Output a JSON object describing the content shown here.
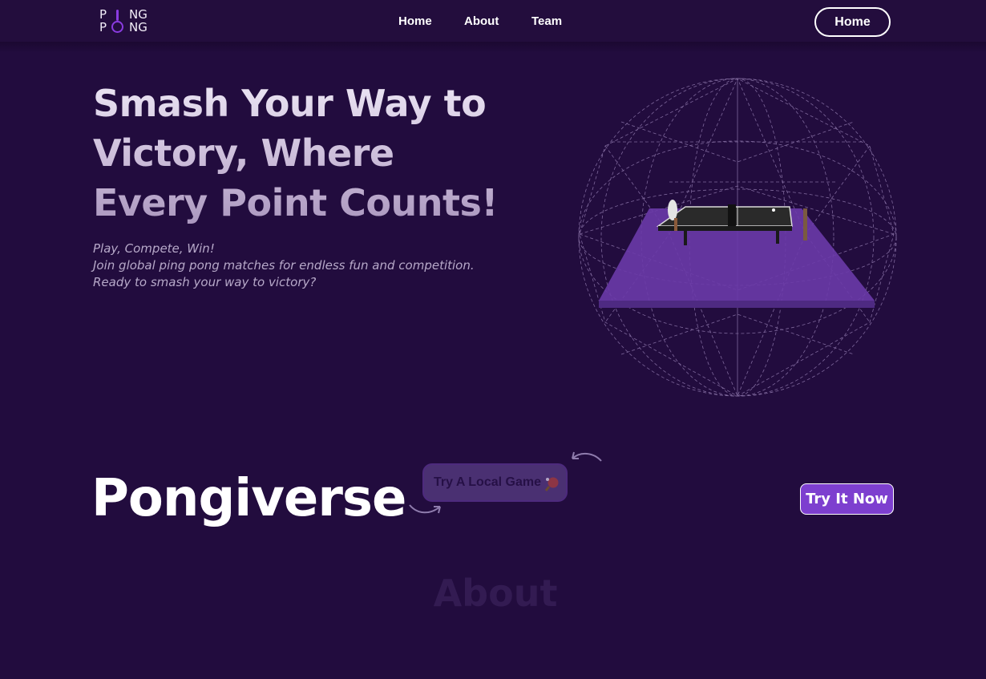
{
  "logo": {
    "top_row": [
      "P",
      "NG"
    ],
    "bottom_row": [
      "P",
      "NG"
    ]
  },
  "nav": {
    "links": [
      "Home",
      "About",
      "Team"
    ],
    "button_label": "Home"
  },
  "hero": {
    "title": "Smash Your Way to Victory, Where Every Point Counts!",
    "subtitle_lines": [
      "Play, Compete, Win!",
      "Join global ping pong matches for endless fun and competition.",
      "Ready to smash your way to victory?"
    ]
  },
  "scene": {
    "globe_color": "#9d86bb",
    "table_floor_color": "#6a3aa8",
    "table_top_color": "#2a2a2a"
  },
  "section": {
    "brand": "Pongiverse",
    "local_game_label": "Try A Local Game",
    "cta_label": "Try It Now"
  },
  "about": {
    "title": "About"
  },
  "colors": {
    "background": "#220c3e",
    "accent": "#7d3fcf",
    "nav_bg": "#230d3d"
  }
}
